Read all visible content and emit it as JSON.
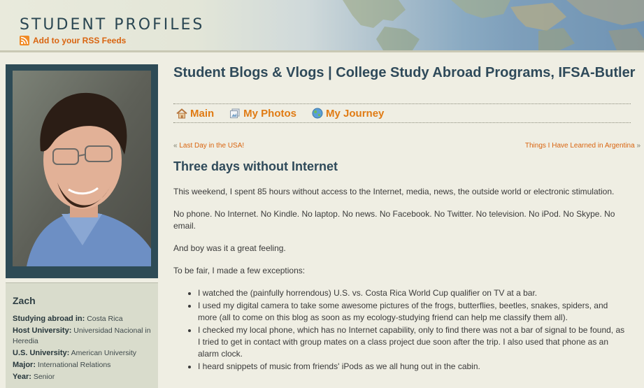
{
  "header": {
    "site_title": "STUDENT PROFILES",
    "rss_label": "Add to your RSS Feeds"
  },
  "profile": {
    "name": "Zach",
    "fields": [
      {
        "label": "Studying abroad in:",
        "value": "Costa Rica"
      },
      {
        "label": "Host University:",
        "value": "Universidad Nacional in Heredia"
      },
      {
        "label": "U.S. University:",
        "value": "American University"
      },
      {
        "label": "Major:",
        "value": "International Relations"
      },
      {
        "label": "Year:",
        "value": "Senior"
      }
    ]
  },
  "main": {
    "blog_title": "Student Blogs & Vlogs | College Study Abroad Programs, IFSA-Butler",
    "nav": [
      {
        "label": "Main",
        "icon": "home-icon"
      },
      {
        "label": "My Photos",
        "icon": "photos-icon"
      },
      {
        "label": "My Journey",
        "icon": "globe-icon"
      }
    ],
    "prev": {
      "marker": "«",
      "label": "Last Day in the USA!"
    },
    "next": {
      "marker": "»",
      "label": "Things I Have Learned in Argentina"
    },
    "post": {
      "title": "Three days without Internet",
      "paragraphs": [
        "This weekend, I spent 85 hours without access to the Internet, media, news, the outside world or electronic stimulation.",
        "No phone. No Internet. No Kindle. No laptop. No news. No Facebook. No Twitter. No television. No iPod. No Skype. No email.",
        "And boy was it a great feeling.",
        "To be fair, I made a few exceptions:"
      ],
      "bullets": [
        "I watched the (painfully horrendous) U.S. vs. Costa Rica World Cup qualifier on TV at a bar.",
        "I used my digital camera to take some awesome pictures of the frogs, butterflies, beetles, snakes, spiders, and more (all to come on this blog as soon as my ecology-studying friend can help me classify them all).",
        "I checked my local phone, which has no Internet capability, only to find there was not a bar of signal to be found, as I tried to get in contact with group mates on a class project due soon after the trip. I also used that phone as an alarm clock.",
        "I heard snippets of music from friends' iPods as we all hung out in the cabin."
      ]
    }
  },
  "colors": {
    "accent": "#e07b14",
    "title": "#2f4a5a",
    "sidebar_frame": "#2e4b56",
    "background": "#efeee3"
  }
}
